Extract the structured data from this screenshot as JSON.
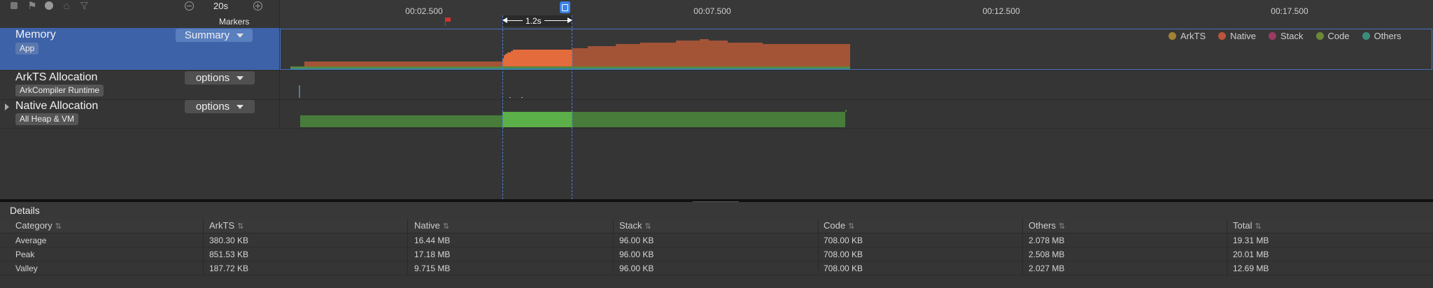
{
  "toolbar": {
    "duration": "20s"
  },
  "ruler": {
    "ticks": [
      "00:02.500",
      "00:07.500",
      "00:12.500",
      "00:17.500"
    ],
    "markers_label": "Markers",
    "selection_label": "1.2s"
  },
  "lanes": [
    {
      "title": "Memory",
      "tag": "App",
      "dropdown": "Summary"
    },
    {
      "title": "ArkTS Allocation",
      "tag": "ArkCompiler Runtime",
      "dropdown": "options"
    },
    {
      "title": "Native Allocation",
      "tag": "All Heap & VM",
      "dropdown": "options"
    }
  ],
  "legend": [
    {
      "name": "ArkTS",
      "color": "#a08332"
    },
    {
      "name": "Native",
      "color": "#b8553a"
    },
    {
      "name": "Stack",
      "color": "#9c3b62"
    },
    {
      "name": "Code",
      "color": "#6b8a36"
    },
    {
      "name": "Others",
      "color": "#3b8c7c"
    }
  ],
  "details": {
    "title": "Details",
    "columns": [
      "Category",
      "ArkTS",
      "Native",
      "Stack",
      "Code",
      "Others",
      "Total"
    ],
    "rows": [
      [
        "Average",
        "380.30 KB",
        "16.44 MB",
        "96.00 KB",
        "708.00 KB",
        "2.078 MB",
        "19.31 MB"
      ],
      [
        "Peak",
        "851.53 KB",
        "17.18 MB",
        "96.00 KB",
        "708.00 KB",
        "2.508 MB",
        "20.01 MB"
      ],
      [
        "Valley",
        "187.72 KB",
        "9.715 MB",
        "96.00 KB",
        "708.00 KB",
        "2.027 MB",
        "12.69 MB"
      ]
    ]
  }
}
